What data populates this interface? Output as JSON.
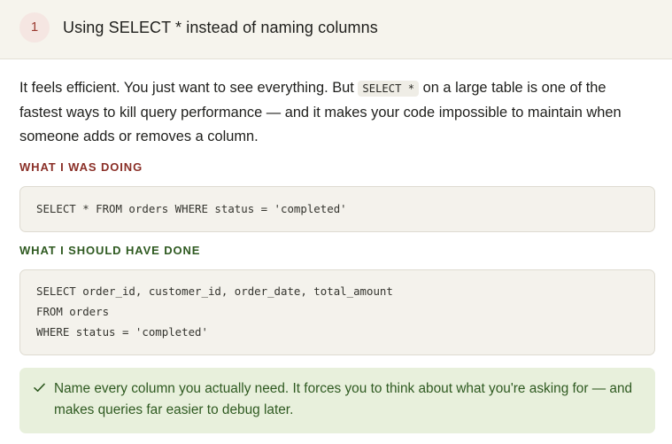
{
  "header": {
    "number": "1",
    "title": "Using SELECT * instead of naming columns"
  },
  "intro": {
    "text_before": "It feels efficient. You just want to see everything. But ",
    "inline_code": "SELECT *",
    "text_after": " on a large table is one of the fastest ways to kill query performance — and it makes your code impossible to maintain when someone adds or removes a column."
  },
  "bad": {
    "label": "WHAT I WAS DOING",
    "code": [
      "SELECT * FROM orders WHERE status = 'completed'"
    ]
  },
  "good": {
    "label": "WHAT I SHOULD HAVE DONE",
    "code": [
      "SELECT order_id, customer_id, order_date, total_amount",
      "FROM orders",
      "WHERE status = 'completed'"
    ]
  },
  "tip": {
    "icon": "check-icon",
    "text": "Name every column you actually need. It forces you to think about what you're asking for — and makes queries far easier to debug later."
  },
  "colors": {
    "bad_label": "#8a2f27",
    "good_label": "#2f5a21",
    "tip_background": "#e8f0dc",
    "badge_background": "#f5e6e2"
  }
}
